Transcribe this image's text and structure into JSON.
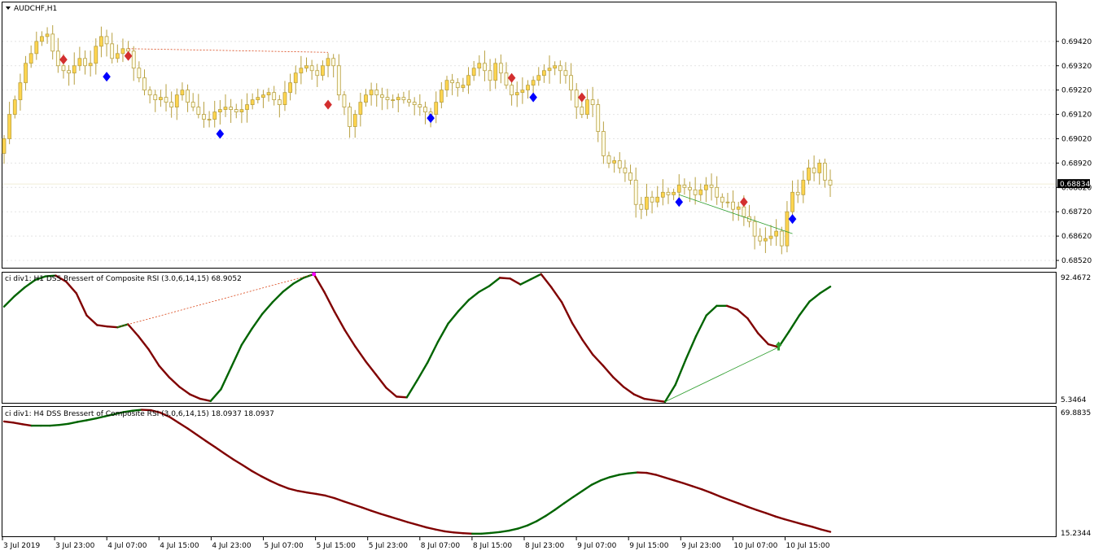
{
  "chart_title": "AUDCHF,H1",
  "current_price": "0.68834",
  "colors": {
    "bull_candle": "#ffd54f",
    "bear_candle": "#fffde7",
    "wick": "#b8a040",
    "up_line": "#006400",
    "down_line": "#800000",
    "bull_marker": "#0000ff",
    "bear_marker": "#d32f2f",
    "bear_divergence": "#d84315",
    "bull_divergence": "#2e9e2e"
  },
  "panel1": {
    "label": "ci div1: H1 DSS Bressert of Composite RSI (3.0,6,14,15) 68.9052",
    "max_label": "92.4672",
    "min_label": "5.3464"
  },
  "panel2": {
    "label": "ci div1: H4 DSS Bressert of Composite RSI (3.0,6,14,15) 18.0937 18.0937",
    "max_label": "69.8835",
    "min_label": "15.2344"
  },
  "time_labels": [
    "3 Jul 2019",
    "3 Jul 23:00",
    "4 Jul 07:00",
    "4 Jul 15:00",
    "4 Jul 23:00",
    "5 Jul 07:00",
    "5 Jul 15:00",
    "5 Jul 23:00",
    "8 Jul 07:00",
    "8 Jul 15:00",
    "8 Jul 23:00",
    "9 Jul 07:00",
    "9 Jul 15:00",
    "9 Jul 23:00",
    "10 Jul 07:00",
    "10 Jul 15:00"
  ],
  "chart_data": [
    {
      "type": "candlestick",
      "title": "AUDCHF,H1",
      "yticks": [
        "0.69420",
        "0.69320",
        "0.69220",
        "0.69120",
        "0.69020",
        "0.68920",
        "0.68820",
        "0.68720",
        "0.68620",
        "0.68520"
      ],
      "ylim": [
        0.6849,
        0.6958
      ],
      "current": 0.68834,
      "closes": [
        0.6902,
        0.6912,
        0.6918,
        0.6925,
        0.6933,
        0.6937,
        0.6942,
        0.6944,
        0.6945,
        0.6938,
        0.6932,
        0.693,
        0.6929,
        0.6932,
        0.6935,
        0.6932,
        0.6933,
        0.694,
        0.6944,
        0.6941,
        0.6935,
        0.6937,
        0.6939,
        0.6938,
        0.6931,
        0.6927,
        0.6922,
        0.692,
        0.6918,
        0.6919,
        0.6917,
        0.6915,
        0.692,
        0.6922,
        0.6917,
        0.6915,
        0.6912,
        0.691,
        0.691,
        0.6913,
        0.6914,
        0.6915,
        0.6914,
        0.6913,
        0.6914,
        0.6916,
        0.6918,
        0.6919,
        0.692,
        0.6921,
        0.6918,
        0.6916,
        0.6921,
        0.6925,
        0.6929,
        0.6931,
        0.6932,
        0.693,
        0.6928,
        0.6932,
        0.6935,
        0.6932,
        0.692,
        0.6915,
        0.6907,
        0.6912,
        0.6917,
        0.692,
        0.6922,
        0.692,
        0.6919,
        0.6918,
        0.6918,
        0.6919,
        0.6918,
        0.6917,
        0.6916,
        0.6915,
        0.6913,
        0.6912,
        0.6917,
        0.6922,
        0.6926,
        0.6925,
        0.6923,
        0.6924,
        0.6928,
        0.6931,
        0.6933,
        0.693,
        0.6926,
        0.6933,
        0.6929,
        0.6924,
        0.692,
        0.6921,
        0.6922,
        0.6924,
        0.6926,
        0.6928,
        0.693,
        0.6931,
        0.6932,
        0.693,
        0.6928,
        0.6922,
        0.6915,
        0.6912,
        0.6918,
        0.6916,
        0.6905,
        0.6895,
        0.6892,
        0.6893,
        0.689,
        0.6888,
        0.6885,
        0.6875,
        0.6873,
        0.6878,
        0.6876,
        0.6878,
        0.688,
        0.6879,
        0.688,
        0.6883,
        0.6882,
        0.6881,
        0.6879,
        0.6881,
        0.6883,
        0.6882,
        0.6878,
        0.6876,
        0.6876,
        0.6873,
        0.6874,
        0.687,
        0.6868,
        0.6862,
        0.686,
        0.6861,
        0.6862,
        0.6864,
        0.6858,
        0.6872,
        0.688,
        0.6879,
        0.6885,
        0.689,
        0.6888,
        0.6892,
        0.6885,
        0.6883
      ]
    },
    {
      "type": "line",
      "title": "ci div1: H1 DSS Bressert of Composite RSI (3.0,6,14,15) 68.9052",
      "ylim": [
        5.3464,
        92.4672
      ],
      "values": [
        70.0,
        77.0,
        83.0,
        88.0,
        90.5,
        91.0,
        87.0,
        79.0,
        64.0,
        57.5,
        56.5,
        56.0,
        58.0,
        50.0,
        41.0,
        30.0,
        22.0,
        15.5,
        10.5,
        7.5,
        6.0,
        14.0,
        29.0,
        44.0,
        55.0,
        65.0,
        73.0,
        80.0,
        85.5,
        89.5,
        92.0,
        80.0,
        66.5,
        54.0,
        43.0,
        33.0,
        24.0,
        15.0,
        9.0,
        8.5,
        20.0,
        32.0,
        46.0,
        58.5,
        67.0,
        74.5,
        80.0,
        84.0,
        89.5,
        89.0,
        85.0,
        88.5,
        92.0,
        83.0,
        73.0,
        59.0,
        47.5,
        37.5,
        30.0,
        22.0,
        15.5,
        10.5,
        7.5,
        6.5,
        5.5,
        17.0,
        34.0,
        50.0,
        64.0,
        70.5,
        70.5,
        68.0,
        62.0,
        52.0,
        44.5,
        42.5,
        53.0,
        64.0,
        73.5,
        79.0,
        83.5
      ]
    },
    {
      "type": "line",
      "title": "ci div1: H4 DSS Bressert of Composite RSI (3.0,6,14,15) 18.0937 18.0937",
      "ylim": [
        15.2344,
        69.8835
      ],
      "values": [
        64.0,
        63.5,
        62.8,
        62.2,
        62.2,
        62.2,
        62.5,
        63.0,
        63.8,
        64.5,
        65.3,
        66.2,
        67.1,
        68.0,
        68.6,
        69.0,
        68.8,
        67.8,
        66.0,
        63.5,
        61.0,
        58.3,
        55.6,
        53.0,
        50.3,
        47.7,
        45.3,
        42.8,
        40.6,
        38.6,
        36.8,
        35.3,
        34.3,
        33.6,
        33.0,
        32.3,
        31.2,
        29.8,
        28.5,
        27.2,
        25.8,
        24.5,
        23.3,
        22.1,
        20.9,
        19.8,
        18.7,
        17.8,
        17.0,
        16.5,
        16.2,
        16.0,
        16.0,
        16.3,
        16.7,
        17.3,
        18.2,
        19.5,
        21.3,
        23.6,
        26.2,
        29.0,
        31.7,
        34.3,
        36.9,
        38.8,
        40.2,
        41.2,
        41.8,
        42.2,
        42.0,
        41.2,
        40.0,
        38.8,
        37.6,
        36.3,
        35.0,
        33.5,
        31.9,
        30.4,
        29.0,
        27.5,
        26.1,
        24.8,
        23.4,
        22.2,
        21.1,
        20.0,
        19.0,
        17.8,
        16.8
      ]
    }
  ]
}
